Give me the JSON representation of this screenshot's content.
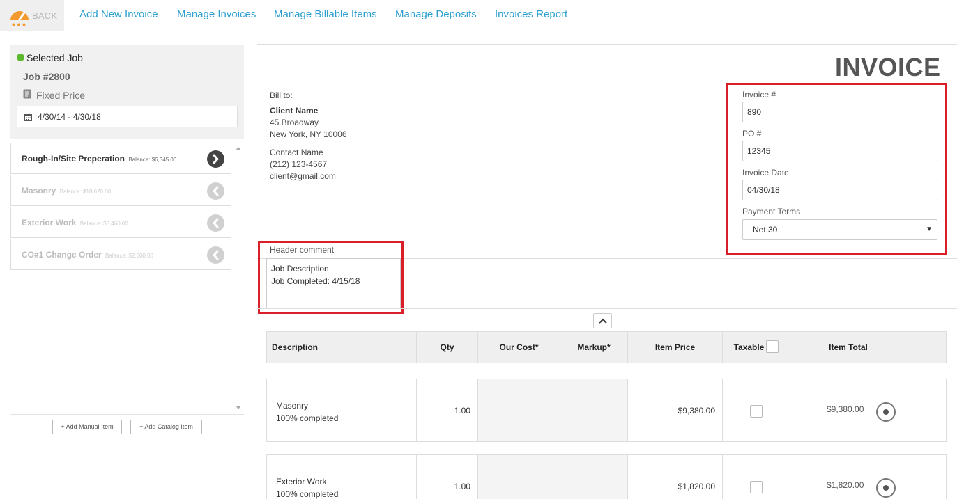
{
  "topnav": {
    "back_label": "BACK",
    "links": [
      "Add New Invoice",
      "Manage Invoices",
      "Manage Billable Items",
      "Manage Deposits",
      "Invoices Report"
    ],
    "accent_color": "#2b9fcf"
  },
  "job": {
    "selected_label": "Selected Job",
    "number": "Job #2800",
    "price_type": "Fixed Price",
    "date_range": "4/30/14 - 4/30/18"
  },
  "phases": [
    {
      "name": "Rough-In/Site Preperation",
      "balance": "Balance: $6,345.00",
      "active": true
    },
    {
      "name": "Masonry",
      "balance": "Balance: $18,620.00",
      "active": false
    },
    {
      "name": "Exterior Work",
      "balance": "Balance: $5,460.00",
      "active": false
    },
    {
      "name": "CO#1 Change Order",
      "balance": "Balance: $2,000.00",
      "active": false
    }
  ],
  "left_buttons": {
    "add_manual": "+ Add Manual Item",
    "add_catalog": "+ Add Catalog Item"
  },
  "invoice": {
    "title": "INVOICE",
    "bill_to_label": "Bill to:",
    "client_name": "Client Name",
    "address_1": "45 Broadway",
    "address_2": "New York, NY 10006",
    "contact_name": "Contact Name",
    "phone": "(212) 123-4567",
    "email": "client@gmail.com",
    "fields": {
      "invoice_no_label": "Invoice #",
      "invoice_no": "890",
      "po_label": "PO #",
      "po": "12345",
      "date_label": "Invoice Date",
      "date": "04/30/18",
      "terms_label": "Payment Terms",
      "terms": "Net 30"
    },
    "header_comment_label": "Header comment",
    "header_comment_line1": "Job Description",
    "header_comment_line2": "Job Completed: 4/15/18",
    "highlight_color": "#d9202a"
  },
  "table": {
    "headers": {
      "description": "Description",
      "qty": "Qty",
      "our_cost": "Our Cost*",
      "markup": "Markup*",
      "item_price": "Item Price",
      "taxable": "Taxable",
      "item_total": "Item Total"
    },
    "rows": [
      {
        "description": "Masonry",
        "progress": "100% completed",
        "qty": "1.00",
        "item_price": "$9,380.00",
        "item_total": "$9,380.00"
      },
      {
        "description": "Exterior Work",
        "progress": "100% completed",
        "qty": "1.00",
        "item_price": "$1,820.00",
        "item_total": "$1,820.00"
      }
    ]
  }
}
